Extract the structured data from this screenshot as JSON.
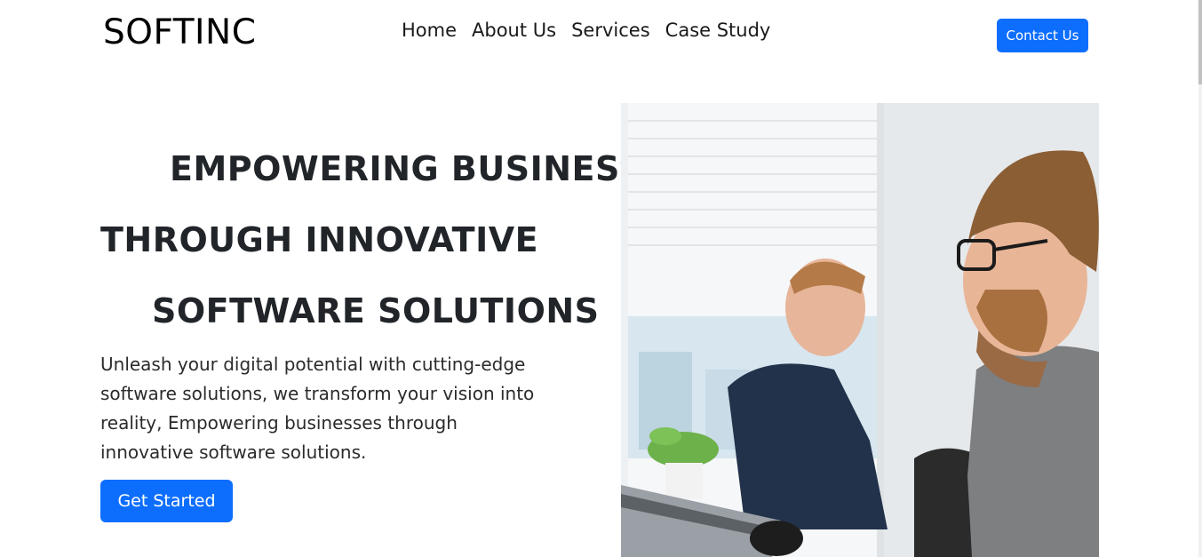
{
  "brand": "SOFTINC",
  "nav": {
    "items": [
      {
        "label": "Home"
      },
      {
        "label": "About Us"
      },
      {
        "label": "Services"
      },
      {
        "label": "Case Study"
      }
    ],
    "contact_label": "Contact Us"
  },
  "hero": {
    "lines": [
      "EMPOWERING BUSINESSES",
      "THROUGH INNOVATIVE",
      "SOFTWARE SOLUTIONS"
    ],
    "description": "Unleash your digital potential with cutting-edge software solutions, we transform your vision into reality, Empowering businesses through innovative software solutions.",
    "cta_label": "Get Started"
  },
  "colors": {
    "accent": "#0d6efd",
    "text": "#212529"
  }
}
